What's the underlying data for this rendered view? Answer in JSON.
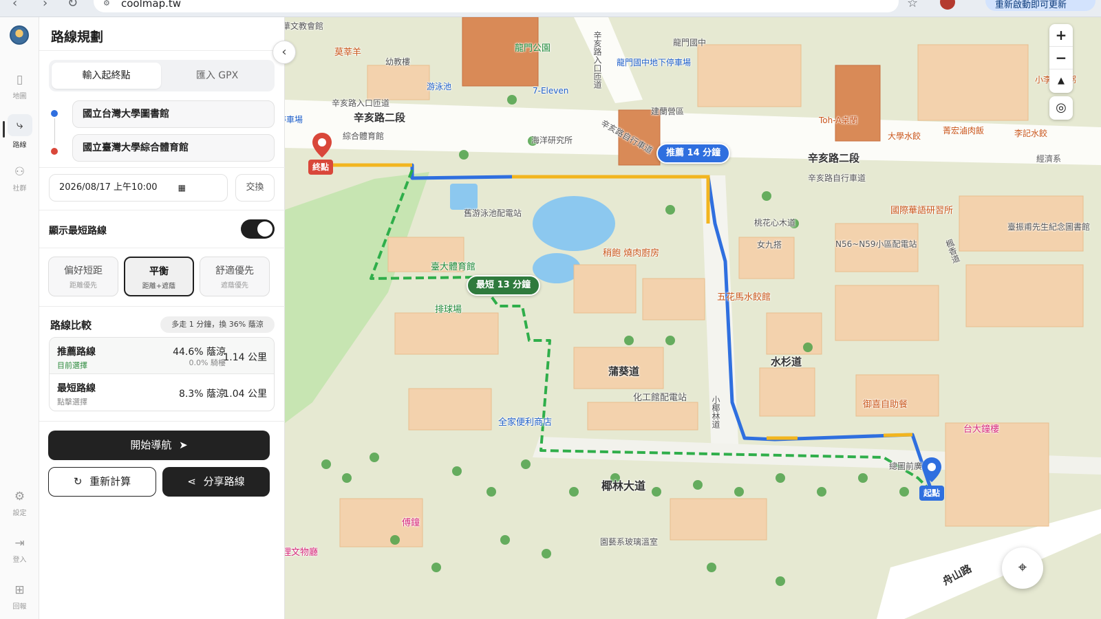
{
  "browser": {
    "url": "coolmap.tw",
    "update_label": "重新啟動即可更新"
  },
  "rail": {
    "items": [
      {
        "label": "地圖",
        "icon": "map-icon"
      },
      {
        "label": "路線",
        "icon": "route-icon"
      },
      {
        "label": "社群",
        "icon": "community-icon"
      },
      {
        "label": "設定",
        "icon": "gear-icon"
      },
      {
        "label": "登入",
        "icon": "login-icon"
      },
      {
        "label": "回報",
        "icon": "feedback-icon"
      }
    ]
  },
  "panel": {
    "title": "路線規劃",
    "tabs": [
      {
        "label": "輸入起終點",
        "active": true
      },
      {
        "label": "匯入 GPX",
        "active": false
      }
    ],
    "origin": "國立台灣大學圖書館",
    "destination": "國立臺灣大學綜合體育館",
    "datetime": "2026/08/17 上午10:00",
    "swap_label": "交換",
    "toggle_label": "顯示最短路線",
    "toggle_on": true,
    "modes": [
      {
        "title": "偏好短距",
        "sub": "距離優先",
        "active": false
      },
      {
        "title": "平衡",
        "sub": "距離+遮蔭",
        "active": true
      },
      {
        "title": "舒適優先",
        "sub": "遮蔭優先",
        "active": false
      }
    ],
    "compare": {
      "title": "路線比較",
      "badge": "多走 1 分鐘，換 36% 蔭涼",
      "rows": [
        {
          "name": "推薦路線",
          "sub": "目前選擇",
          "shade": "44.6% 蔭涼",
          "arcade": "0.0% 騎樓",
          "distance": "1.14 公里"
        },
        {
          "name": "最短路線",
          "sub": "點擊選擇",
          "shade": "8.3% 蔭涼",
          "arcade": "",
          "distance": "1.04 公里"
        }
      ]
    },
    "start_nav": "開始導航",
    "recalc": "重新計算",
    "share": "分享路線"
  },
  "map": {
    "recommended_pill": "推薦 14 分鐘",
    "shortest_pill": "最短 13 分鐘",
    "start_tag": "起點",
    "end_tag": "終點",
    "labels": {
      "wenhui": "華文教會館",
      "mos": "莫莘羊",
      "kindergarten": "幼教樓",
      "longmen_park": "龍門公園",
      "longmen_jr": "龍門國中",
      "longmen_parking": "龍門國中地下停車場",
      "xinhai_gate": "辛亥路入口匝道",
      "xinhai_gate_v": "辛亥路入口匝道",
      "xinhai2_left": "辛亥路二段",
      "xinhai2_right": "辛亥路二段",
      "xinhai_bike": "辛亥路自行車道",
      "xinhai_bike2": "辛亥路自行車道",
      "pool": "游泳池",
      "seven": "7-Eleven",
      "parking": "停車場",
      "gym": "綜合體育館",
      "ocean": "海洋研究所",
      "jianzhu": "建蘭營區",
      "tohaa": "Toh-A桌蘭",
      "daxue_juice": "大學水餃",
      "jhuangjia": "菁宏滷肉飯",
      "lisz": "李記水餃",
      "jingji": "經濟系",
      "xiaoli": "小李子清粥",
      "huayu": "國際華語研習所",
      "pool_power": "舊游泳池配電站",
      "taohua": "桃花心木道",
      "nvjiu": "女九搭",
      "n56": "N56~N59小區配電站",
      "fengxiang": "楓香道",
      "xiang": "臺振甫先生紀念圖書館",
      "shaobao": "稍飽 燒肉廚房",
      "stadium": "臺大體育館",
      "volley": "排球場",
      "wuhua": "五花馬水餃館",
      "shuishan": "水杉道",
      "puqui": "蒲葵道",
      "chem_power": "化工館配電站",
      "yeshu_small": "小椰林道",
      "yuxi": "御喜自助餐",
      "bell_tower": "台大鐘樓",
      "family": "全家便利商店",
      "zongtu": "總圖前廣場",
      "yelin": "椰林大道",
      "fuzhong": "傅鐘",
      "museum": "理文物廳",
      "greenhouse": "園藝系玻璃溫室",
      "zhoushan": "舟山路"
    }
  },
  "colors": {
    "recommended": "#2f6fdf",
    "shortest": "#2fae4a",
    "accent_yellow": "#f2b51f",
    "dark": "#222222",
    "end_red": "#d9473a"
  }
}
